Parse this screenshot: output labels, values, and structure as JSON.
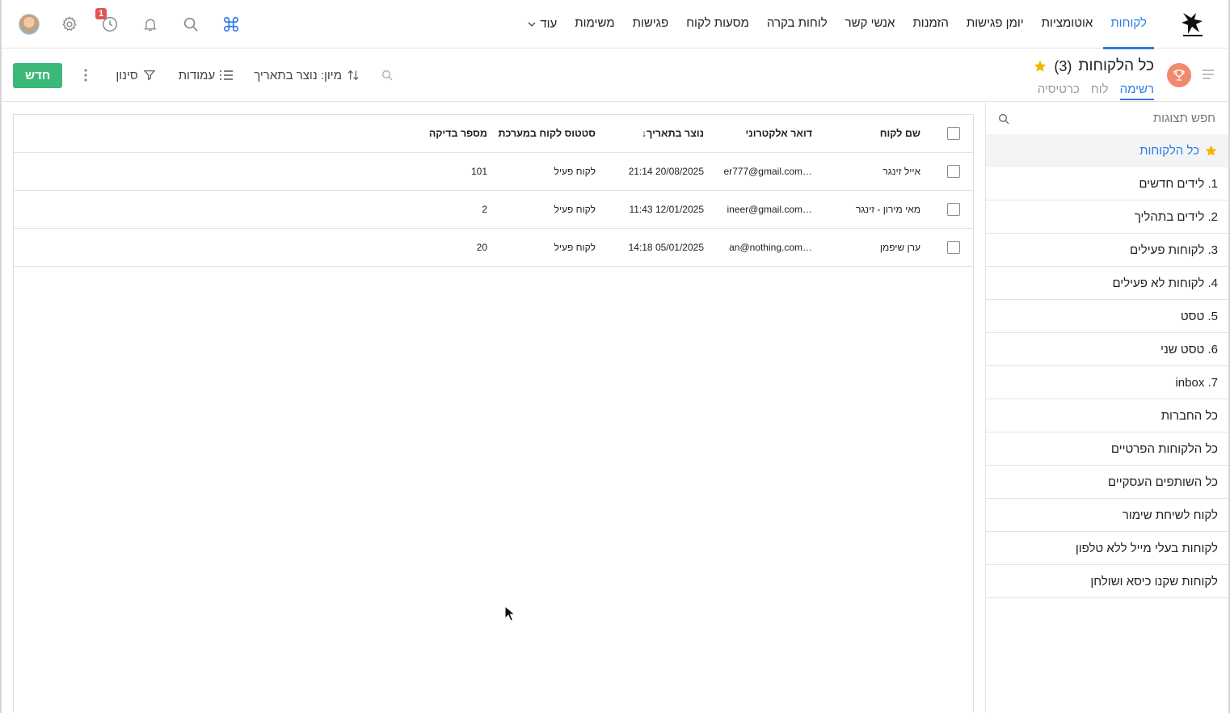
{
  "nav": {
    "items": [
      "לקוחות",
      "אוטומציות",
      "יומן פגישות",
      "הזמנות",
      "אנשי קשר",
      "לוחות בקרה",
      "מסעות לקוח",
      "פגישות",
      "משימות"
    ],
    "active_index": 0,
    "more_label": "עוד"
  },
  "top_icons": {
    "history_badge": "1",
    "accent_color": "#2c7be5"
  },
  "view": {
    "title": "כל הלקוחות",
    "count": "(3)",
    "tabs": [
      "רשימה",
      "לוח",
      "כרטיסיה"
    ],
    "active_tab": 0
  },
  "toolbar": {
    "new_label": "חדש",
    "filter_label": "סינון",
    "columns_label": "עמודות",
    "sort_label": "מיון: נוצר בתאריך"
  },
  "sidebar": {
    "search_placeholder": "חפש תצוגות",
    "items": [
      "כל הלקוחות",
      "1. לידים חדשים",
      "2. לידים בתהליך",
      "3. לקוחות פעילים",
      "4. לקוחות לא פעילים",
      "5. טסט",
      "6. טסט שני",
      "7. inbox",
      "כל החברות",
      "כל הלקוחות הפרטיים",
      "כל השותפים העסקיים",
      "לקוח לשיחת שימור",
      "לקוחות בעלי מייל ללא טלפון",
      "לקוחות שקנו כיסא ושולחן"
    ]
  },
  "table": {
    "columns": {
      "name": "שם לקוח",
      "email": "דואר אלקטרוני",
      "created": "נוצר בתאריך",
      "status": "סטטוס לקוח במערכת",
      "test_number": "מספר בדיקה"
    },
    "rows": [
      {
        "name": "אייל זינגר",
        "email": "…er777@gmail.com",
        "created": "20/08/2025 21:14",
        "status": "לקוח פעיל",
        "test_number": "101"
      },
      {
        "name": "מאי מירון - זינגר",
        "email": "…ineer@gmail.com",
        "created": "12/01/2025 11:43",
        "status": "לקוח פעיל",
        "test_number": "2"
      },
      {
        "name": "ערן שיפמן",
        "email": "…an@nothing.com",
        "created": "05/01/2025 14:18",
        "status": "לקוח פעיל",
        "test_number": "20"
      }
    ]
  },
  "colors": {
    "primary": "#2c7be5",
    "new_button": "#3cb878",
    "star": "#f2b705",
    "trophy_bg": "#f08a6e",
    "badge": "#e05555"
  }
}
